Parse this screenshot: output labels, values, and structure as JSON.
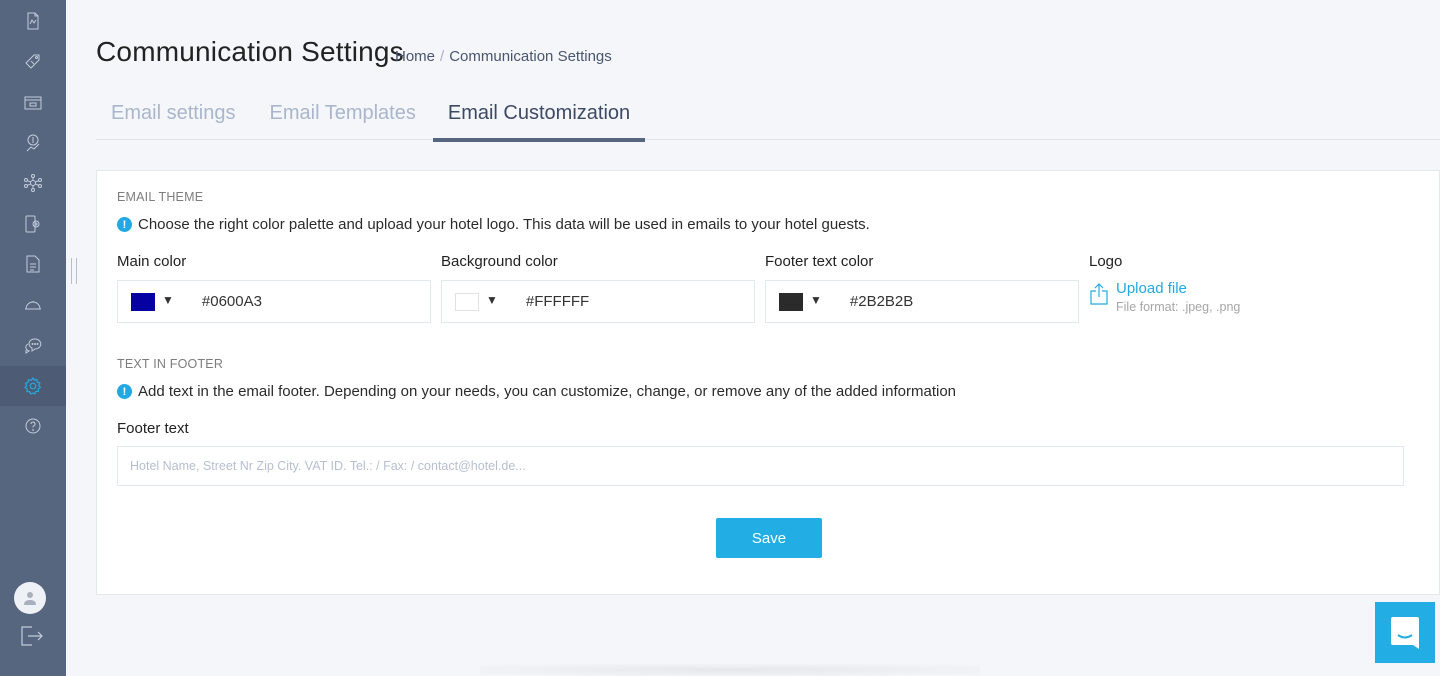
{
  "sidebar": {
    "items": [
      {
        "icon": "report-icon",
        "label": "Reports"
      },
      {
        "icon": "price-tag-icon",
        "label": "Rates"
      },
      {
        "icon": "calendar-window-icon",
        "label": "Inventory"
      },
      {
        "icon": "revenue-growth-icon",
        "label": "Revenue"
      },
      {
        "icon": "network-icon",
        "label": "Channels"
      },
      {
        "icon": "mobile-settings-icon",
        "label": "Booking Engine"
      },
      {
        "icon": "document-icon",
        "label": "Documents"
      },
      {
        "icon": "service-bell-icon",
        "label": "Services"
      },
      {
        "icon": "chat-bubbles-icon",
        "label": "Communication"
      },
      {
        "icon": "gear-icon",
        "label": "Settings",
        "active": true
      },
      {
        "icon": "help-icon",
        "label": "Help"
      }
    ],
    "accent": "#23a9e1"
  },
  "header": {
    "title": "Communication Settings",
    "breadcrumb": [
      "Home",
      "Communication Settings"
    ],
    "breadcrumb_separator": "/"
  },
  "tabs": [
    {
      "label": "Email settings",
      "active": false
    },
    {
      "label": "Email Templates",
      "active": false
    },
    {
      "label": "Email Customization",
      "active": true
    }
  ],
  "email_theme": {
    "section_label": "EMAIL THEME",
    "info": "Choose the right color palette and upload your hotel logo. This data will be used in emails to your hotel guests.",
    "info_icon": "!",
    "main_color": {
      "label": "Main color",
      "value": "#0600A3"
    },
    "background_color": {
      "label": "Background color",
      "value": "#FFFFFF"
    },
    "footer_text_color": {
      "label": "Footer text color",
      "value": "#2B2B2B"
    },
    "caret": "▼",
    "logo": {
      "label": "Logo",
      "upload_label": "Upload file",
      "hint": "File format: .jpeg, .png"
    }
  },
  "footer_section": {
    "section_label": "TEXT IN FOOTER",
    "info": "Add text in the email footer. Depending on your needs, you can customize, change, or remove any of the added information",
    "info_icon": "!",
    "footer_text_label": "Footer text",
    "footer_text_value": "",
    "footer_text_placeholder": "Hotel Name, Street Nr Zip City. VAT ID. Tel.: / Fax: / contact@hotel.de..."
  },
  "actions": {
    "save_label": "Save",
    "primary_color": "#23ade5"
  }
}
